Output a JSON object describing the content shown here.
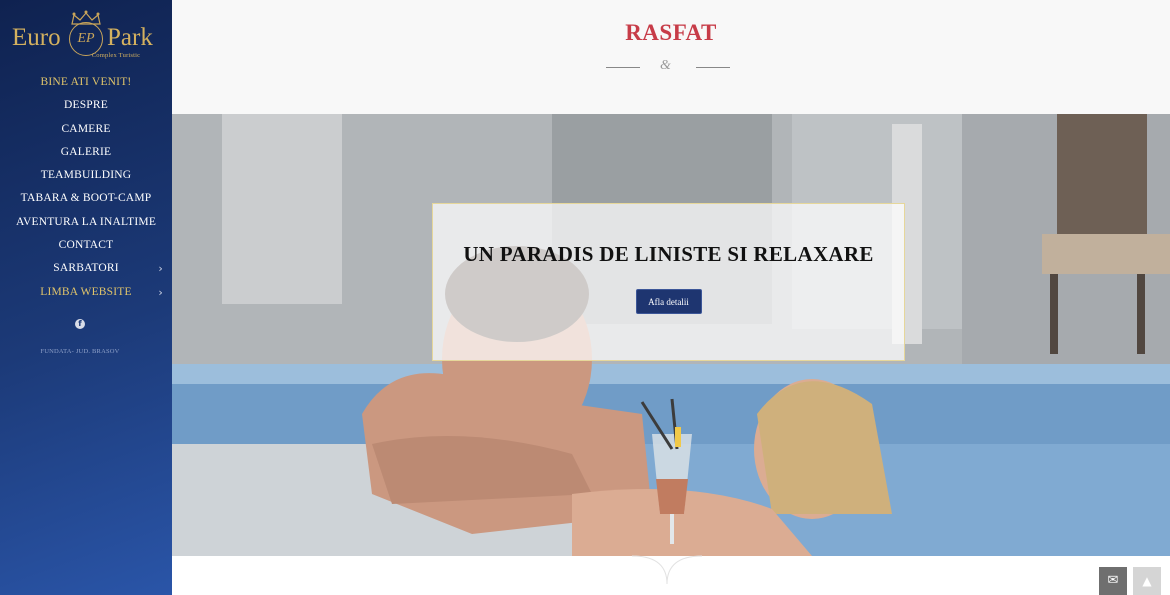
{
  "sidebar": {
    "logo": {
      "left_word": "Euro",
      "right_word": "Park",
      "monogram": "EP",
      "tagline": "Complex Turistic"
    },
    "nav": [
      {
        "label": "BINE ATI VENIT!",
        "active": true,
        "has_submenu": false
      },
      {
        "label": "DESPRE",
        "active": false,
        "has_submenu": false
      },
      {
        "label": "CAMERE",
        "active": false,
        "has_submenu": false
      },
      {
        "label": "GALERIE",
        "active": false,
        "has_submenu": false
      },
      {
        "label": "TEAMBUILDING",
        "active": false,
        "has_submenu": false
      },
      {
        "label": "TABARA & BOOT-CAMP",
        "active": false,
        "has_submenu": false
      },
      {
        "label": "AVENTURA LA INALTIME",
        "active": false,
        "has_submenu": false
      },
      {
        "label": "CONTACT",
        "active": false,
        "has_submenu": false
      },
      {
        "label": "SARBATORI",
        "active": false,
        "has_submenu": true
      },
      {
        "label": "LIMBA WEBSITE",
        "active": false,
        "has_submenu": true
      }
    ],
    "chevron": "›",
    "social_icon": "facebook-icon",
    "social_glyph": "f",
    "address": "FUNDATA- JUD. BRASOV"
  },
  "header": {
    "title": "RASFAT",
    "separator": "&"
  },
  "hero": {
    "heading": "UN PARADIS DE LINISTE SI RELAXARE",
    "button_label": "Afla detalii"
  },
  "floating": {
    "mail_icon": "envelope-icon",
    "mail_glyph": "✉",
    "top_icon": "chevron-up-icon",
    "top_glyph": "▲"
  },
  "colors": {
    "sidebar_top": "#0f2250",
    "sidebar_bottom": "#2a55a8",
    "gold": "#d4b15f",
    "title_red": "#c73c48",
    "button_navy": "#1e3570"
  }
}
